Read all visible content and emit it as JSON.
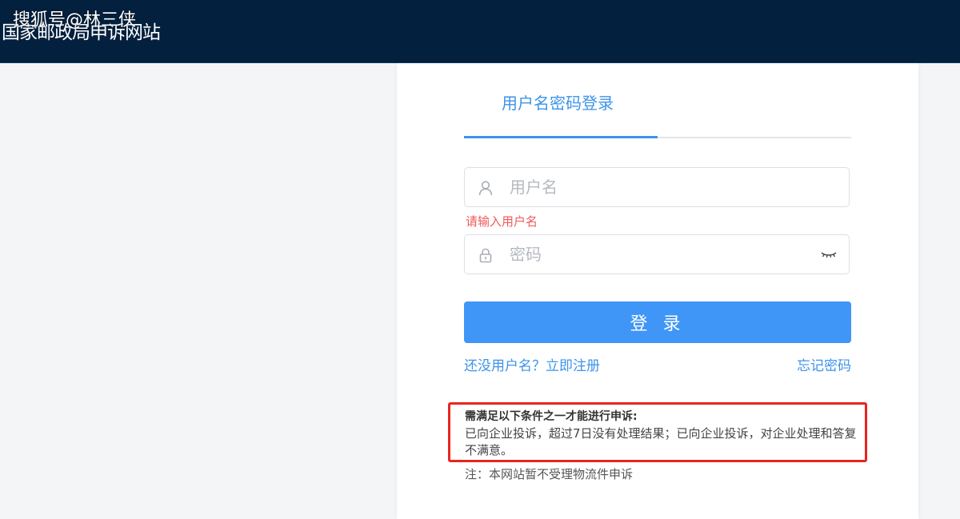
{
  "header": {
    "site_title": "国家邮政局申诉网站",
    "watermark": "搜狐号@林三侠",
    "background_color": "#03203f"
  },
  "login": {
    "tab_label": "用户名密码登录",
    "username": {
      "placeholder": "用户名",
      "value": "",
      "icon": "user-icon"
    },
    "username_error": "请输入用户名",
    "password": {
      "placeholder": "密码",
      "value": "",
      "icon": "lock-icon",
      "toggle_icon": "eye-closed-icon"
    },
    "submit_label": "登 录",
    "register_link": "还没用户名？立即注册",
    "forgot_link": "忘记密码"
  },
  "conditions": {
    "title": "需满足以下条件之一才能进行申诉:",
    "body": "已向企业投诉，超过7日没有处理结果；已向企业投诉，对企业处理和答复不满意。",
    "highlight_color": "#e8261f"
  },
  "note": "注：本网站暂不受理物流件申诉",
  "colors": {
    "accent": "#3d93ea",
    "button": "#3f96f7",
    "error": "#f05a5a"
  }
}
